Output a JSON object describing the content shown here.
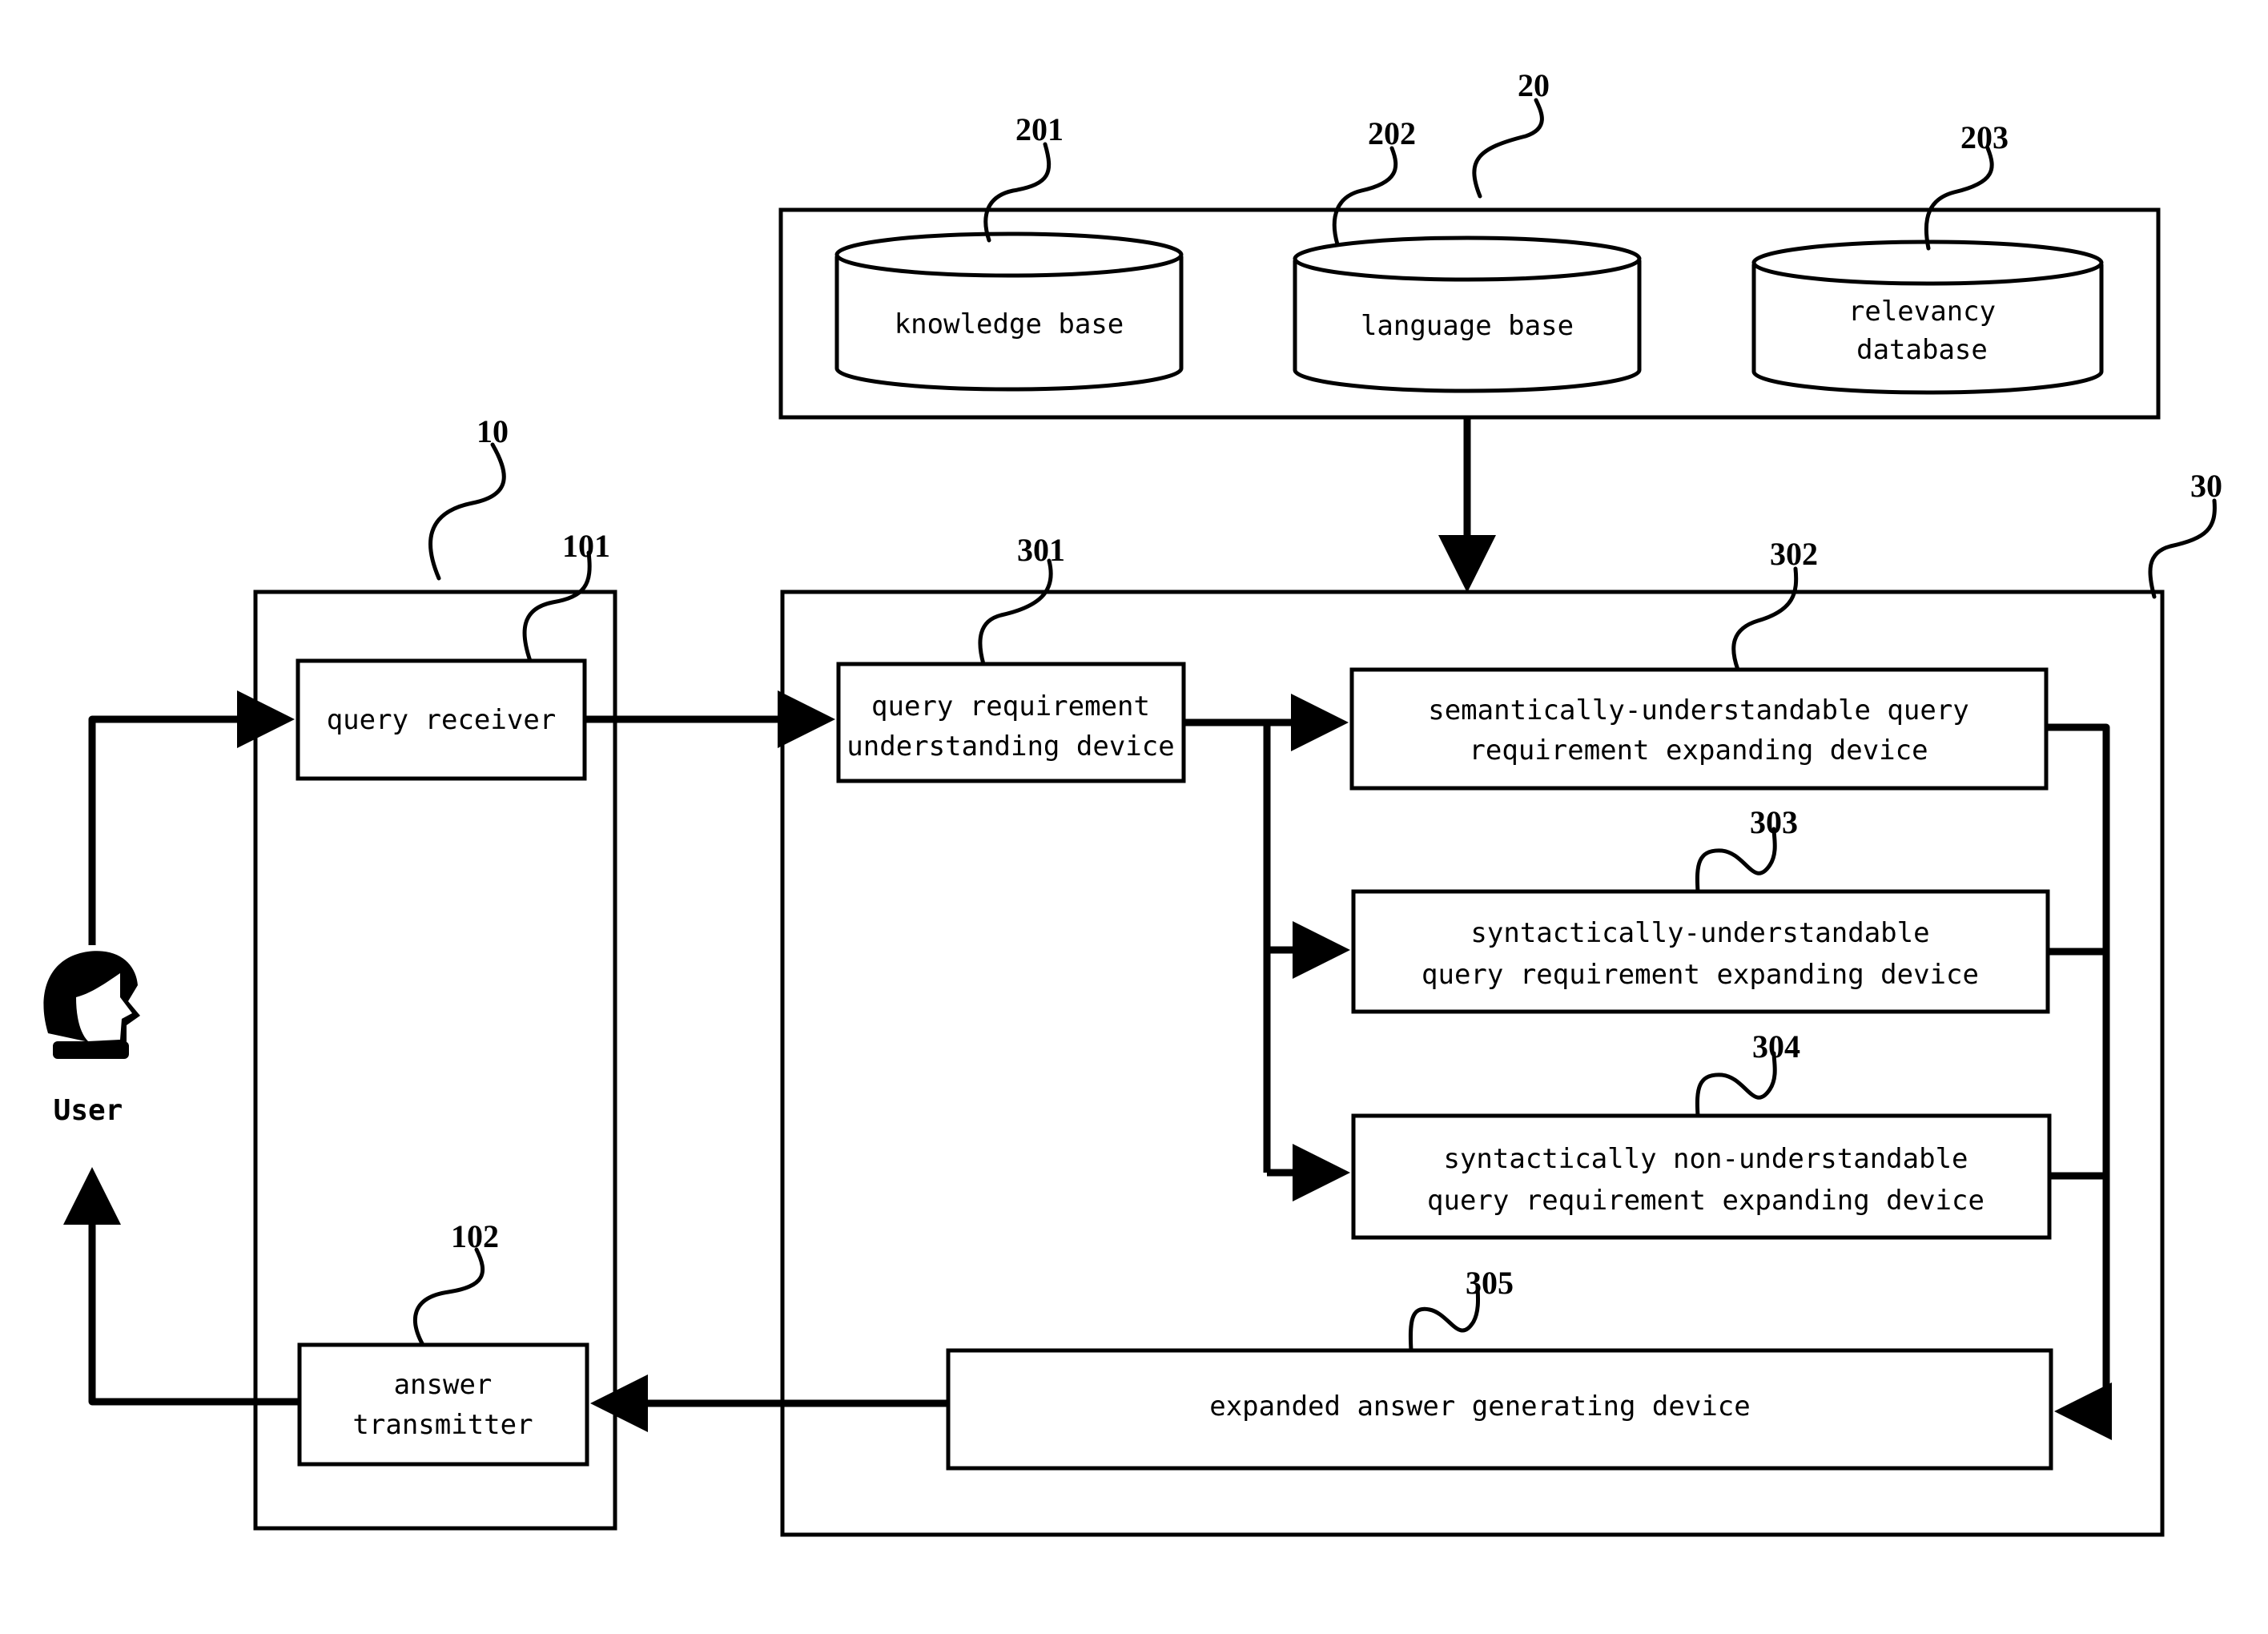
{
  "figure": {
    "user": {
      "label": "User",
      "icon": "user-head-icon"
    },
    "system_10": {
      "ref": "10",
      "query_receiver": {
        "ref": "101",
        "label": [
          "query receiver"
        ]
      },
      "answer_transmitter": {
        "ref": "102",
        "label": [
          "answer",
          "transmitter"
        ]
      }
    },
    "system_20": {
      "ref": "20",
      "databases": [
        {
          "ref": "201",
          "label": [
            "knowledge base"
          ]
        },
        {
          "ref": "202",
          "label": [
            "language base"
          ]
        },
        {
          "ref": "203",
          "label": [
            "relevancy",
            "database"
          ]
        }
      ]
    },
    "system_30": {
      "ref": "30",
      "devices": [
        {
          "ref": "301",
          "label": [
            "query requirement",
            "understanding device"
          ]
        },
        {
          "ref": "302",
          "label": [
            "semantically-understandable query",
            "requirement expanding device"
          ]
        },
        {
          "ref": "303",
          "label": [
            "syntactically-understandable",
            "query requirement expanding device"
          ]
        },
        {
          "ref": "304",
          "label": [
            "syntactically non-understandable",
            "query requirement expanding device"
          ]
        },
        {
          "ref": "305",
          "label": [
            "expanded answer generating device"
          ]
        }
      ]
    },
    "connections": [
      {
        "from": "User",
        "to": "101"
      },
      {
        "from": "101",
        "to": "301"
      },
      {
        "from": "20",
        "to": "30"
      },
      {
        "from": "301",
        "to": "302"
      },
      {
        "from": "301",
        "to": "303"
      },
      {
        "from": "301",
        "to": "304"
      },
      {
        "from": "302",
        "to": "305"
      },
      {
        "from": "303",
        "to": "305"
      },
      {
        "from": "304",
        "to": "305"
      },
      {
        "from": "305",
        "to": "102"
      },
      {
        "from": "102",
        "to": "User"
      }
    ]
  }
}
